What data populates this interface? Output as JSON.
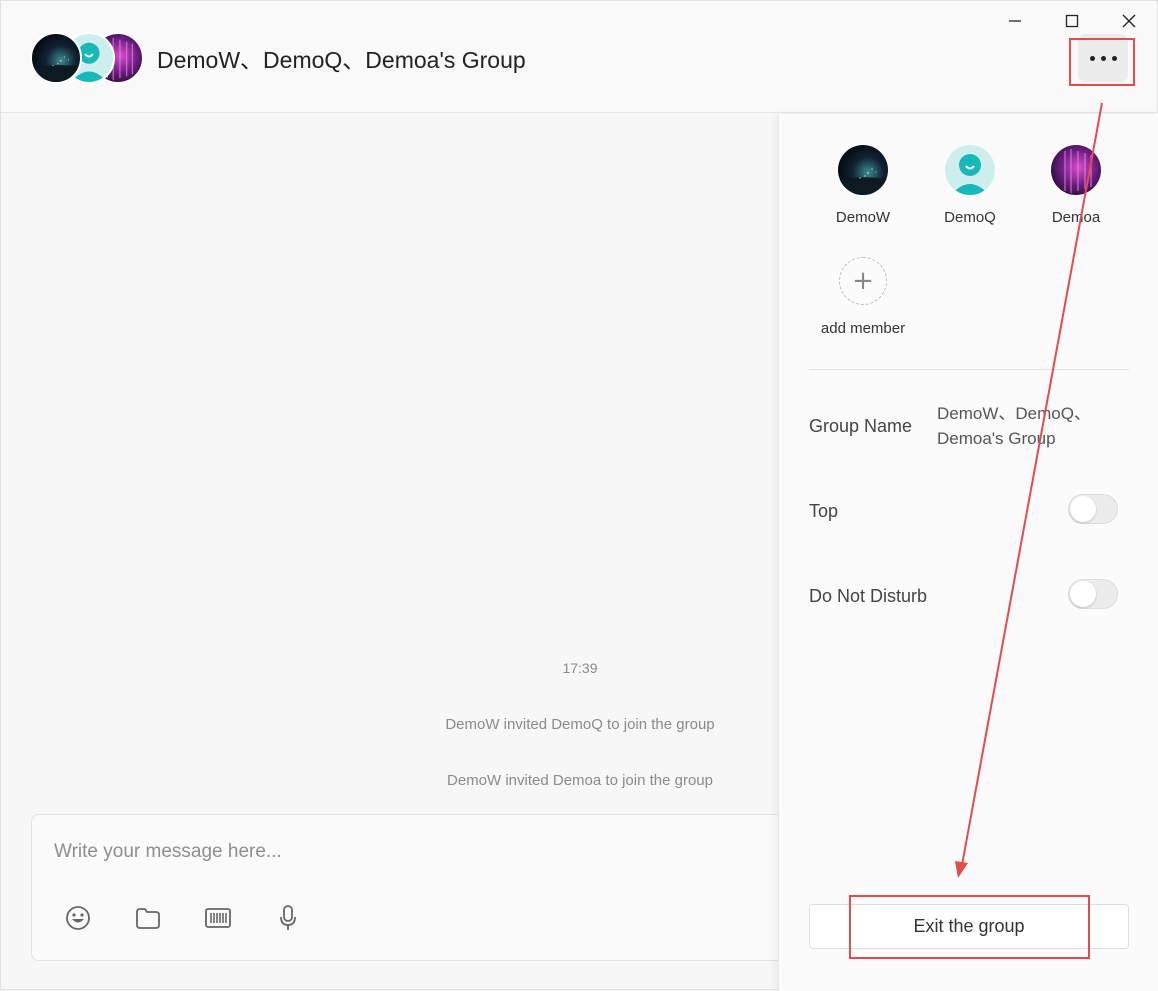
{
  "header": {
    "title": "DemoW、DemoQ、Demoa's Group",
    "avatar_icons": [
      "space-avatar-icon",
      "teal-person-avatar-icon",
      "purple-lights-avatar-icon"
    ]
  },
  "window_controls": {
    "minimize": "—",
    "maximize": "☐",
    "close": "✕"
  },
  "messages": {
    "timestamp": "17:39",
    "system": [
      "DemoW invited DemoQ to join the group",
      "DemoW invited Demoa to join the group"
    ]
  },
  "composer": {
    "placeholder": "Write your message here...",
    "tools": [
      "emoji-icon",
      "folder-icon",
      "barcode-icon",
      "microphone-icon"
    ]
  },
  "panel": {
    "members": [
      {
        "name": "DemoW",
        "icon": "space-avatar-icon"
      },
      {
        "name": "DemoQ",
        "icon": "teal-person-avatar-icon"
      },
      {
        "name": "Demoa",
        "icon": "purple-lights-avatar-icon"
      }
    ],
    "add_member": {
      "label": "add member",
      "symbol": "+"
    },
    "group_name_label": "Group Name",
    "group_name_value_line1": "DemoW、DemoQ、",
    "group_name_value_line2": "Demoa's Group",
    "top_label": "Top",
    "top_enabled": false,
    "dnd_label": "Do Not Disturb",
    "dnd_enabled": false,
    "exit_label": "Exit the group"
  },
  "colors": {
    "annotation": "#e64b4b",
    "background": "#f7f7f7",
    "panel": "#fbfbfb"
  }
}
